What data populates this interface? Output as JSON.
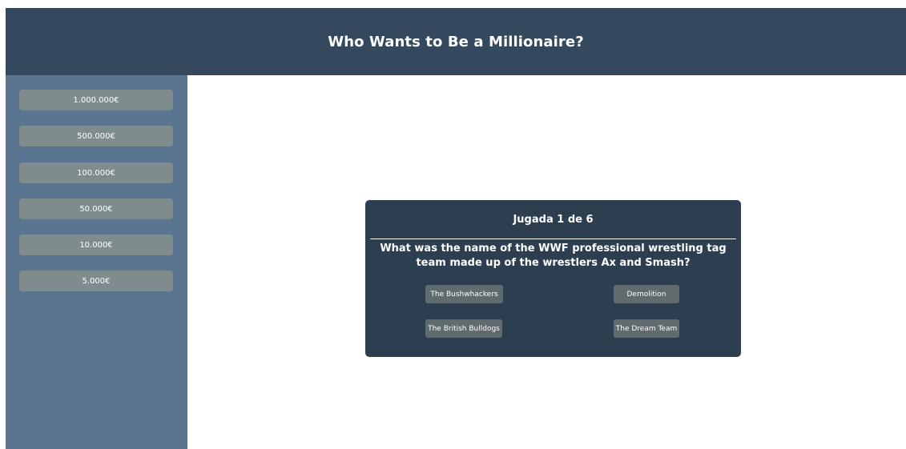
{
  "header": {
    "title": "Who Wants to Be a Millionaire?"
  },
  "prize_ladder": [
    "1.000.000€",
    "500.000€",
    "100.000€",
    "50.000€",
    "10.000€",
    "5.000€"
  ],
  "game": {
    "round_label": "Jugada 1 de 6",
    "question": "What was the name of the WWF professional wrestling tag team made up of the wrestlers Ax and Smash?",
    "answers": [
      "The Bushwhackers",
      "Demolition",
      "The British Bulldogs",
      "The Dream Team"
    ]
  },
  "colors": {
    "header_bg": "#34495e",
    "sidebar_bg": "#5a7590",
    "prize_bg": "#7f8c8d",
    "card_bg": "#2c3e50",
    "answer_bg": "#5f6b6e"
  }
}
